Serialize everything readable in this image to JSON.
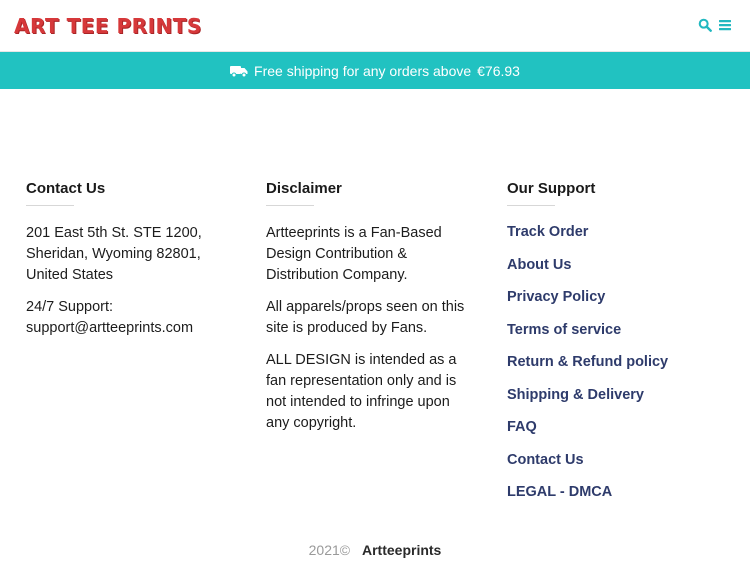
{
  "header": {
    "logo_text": "ART TEE PRINTS",
    "icons": [
      "search-icon",
      "menu-icon"
    ]
  },
  "shipping_bar": {
    "text": "Free shipping for any orders above",
    "amount": "€76.93",
    "icon": "truck-icon",
    "bg_color": "#21c2c1"
  },
  "contact": {
    "heading": "Contact Us",
    "address": "201 East 5th St. STE 1200, Sheridan, Wyoming 82801, United States",
    "support_label": "24/7 Support:",
    "support_email": "support@artteeprints.com"
  },
  "disclaimer": {
    "heading": "Disclaimer",
    "paragraphs": [
      "Artteeprints is a Fan-Based Design Contribution & Distribution Company.",
      "All apparels/props seen on this site is produced by Fans.",
      "ALL DESIGN is intended as a fan representation only and is not intended to infringe upon any copyright."
    ]
  },
  "support": {
    "heading": "Our Support",
    "links": [
      "Track Order",
      "About Us",
      "Privacy Policy",
      "Terms of service",
      "Return & Refund policy",
      "Shipping & Delivery",
      "FAQ",
      "Contact Us",
      "LEGAL - DMCA"
    ],
    "link_color": "#2e3b6b"
  },
  "footer": {
    "year": "2021©",
    "brand": "Artteeprints"
  }
}
